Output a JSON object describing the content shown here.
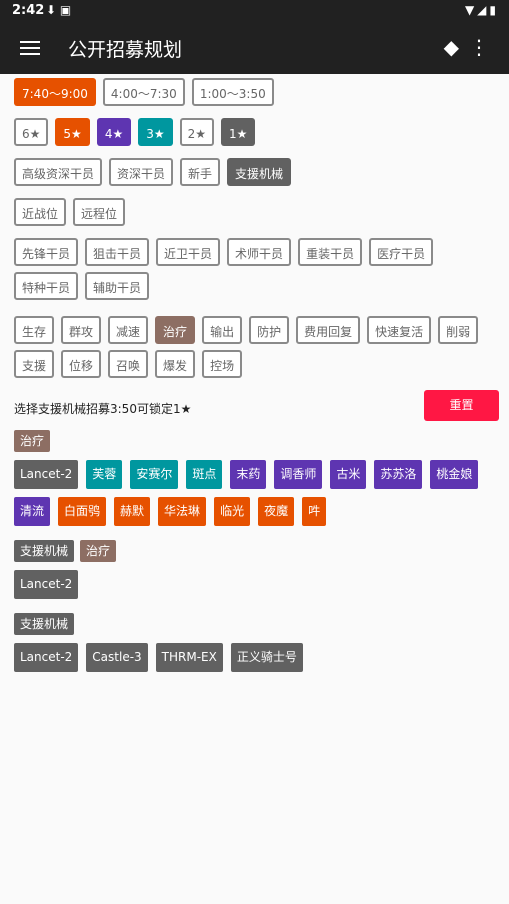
{
  "status": {
    "time": "2:42"
  },
  "appbar": {
    "title": "公开招募规划"
  },
  "time_options": [
    {
      "label": "7:40～9:00",
      "selected": true
    },
    {
      "label": "4:00～7:30",
      "selected": false
    },
    {
      "label": "1:00～3:50",
      "selected": false
    }
  ],
  "stars": [
    {
      "label": "6★",
      "selected": false,
      "color": ""
    },
    {
      "label": "5★",
      "selected": true,
      "color": "orange"
    },
    {
      "label": "4★",
      "selected": true,
      "color": "purple"
    },
    {
      "label": "3★",
      "selected": true,
      "color": "teal"
    },
    {
      "label": "2★",
      "selected": false,
      "color": ""
    },
    {
      "label": "1★",
      "selected": true,
      "color": "gray"
    }
  ],
  "qualifications": [
    {
      "label": "高级资深干员",
      "selected": false
    },
    {
      "label": "资深干员",
      "selected": false
    },
    {
      "label": "新手",
      "selected": false
    },
    {
      "label": "支援机械",
      "selected": true
    }
  ],
  "positions": [
    {
      "label": "近战位",
      "selected": false
    },
    {
      "label": "远程位",
      "selected": false
    }
  ],
  "classes": [
    {
      "label": "先锋干员",
      "selected": false
    },
    {
      "label": "狙击干员",
      "selected": false
    },
    {
      "label": "近卫干员",
      "selected": false
    },
    {
      "label": "术师干员",
      "selected": false
    },
    {
      "label": "重装干员",
      "selected": false
    },
    {
      "label": "医疗干员",
      "selected": false
    },
    {
      "label": "特种干员",
      "selected": false
    },
    {
      "label": "辅助干员",
      "selected": false
    }
  ],
  "affixes": [
    {
      "label": "生存",
      "selected": false
    },
    {
      "label": "群攻",
      "selected": false
    },
    {
      "label": "减速",
      "selected": false
    },
    {
      "label": "治疗",
      "selected": true
    },
    {
      "label": "输出",
      "selected": false
    },
    {
      "label": "防护",
      "selected": false
    },
    {
      "label": "费用回复",
      "selected": false
    },
    {
      "label": "快速复活",
      "selected": false
    },
    {
      "label": "削弱",
      "selected": false
    },
    {
      "label": "支援",
      "selected": false
    },
    {
      "label": "位移",
      "selected": false
    },
    {
      "label": "召唤",
      "selected": false
    },
    {
      "label": "爆发",
      "selected": false
    },
    {
      "label": "控场",
      "selected": false
    }
  ],
  "hint": "选择支援机械招募3:50可锁定1★",
  "reset_label": "重置",
  "results": [
    {
      "tags": [
        {
          "label": "治疗",
          "color": "brown"
        }
      ],
      "operators": [
        {
          "name": "Lancet-2",
          "color": "gray"
        },
        {
          "name": "芙蓉",
          "color": "teal"
        },
        {
          "name": "安赛尔",
          "color": "teal"
        },
        {
          "name": "斑点",
          "color": "teal"
        },
        {
          "name": "末药",
          "color": "purple"
        },
        {
          "name": "调香师",
          "color": "purple"
        },
        {
          "name": "古米",
          "color": "purple"
        },
        {
          "name": "苏苏洛",
          "color": "purple"
        },
        {
          "name": "桃金娘",
          "color": "purple"
        },
        {
          "name": "清流",
          "color": "purple"
        },
        {
          "name": "白面鸮",
          "color": "orange"
        },
        {
          "name": "赫默",
          "color": "orange"
        },
        {
          "name": "华法琳",
          "color": "orange"
        },
        {
          "name": "临光",
          "color": "orange"
        },
        {
          "name": "夜魔",
          "color": "orange"
        },
        {
          "name": "吽",
          "color": "orange"
        }
      ]
    },
    {
      "tags": [
        {
          "label": "支援机械",
          "color": "gray"
        },
        {
          "label": "治疗",
          "color": "brown"
        }
      ],
      "operators": [
        {
          "name": "Lancet-2",
          "color": "gray"
        }
      ]
    },
    {
      "tags": [
        {
          "label": "支援机械",
          "color": "gray"
        }
      ],
      "operators": [
        {
          "name": "Lancet-2",
          "color": "gray"
        },
        {
          "name": "Castle-3",
          "color": "gray"
        },
        {
          "name": "THRM-EX",
          "color": "gray"
        },
        {
          "name": "正义骑士号",
          "color": "gray"
        }
      ]
    }
  ],
  "colors": {
    "appbar": "#212121",
    "orange": "#e65100",
    "purple": "#5e35b1",
    "teal": "#00979f",
    "gray": "#616161",
    "brown": "#8d6e63",
    "reset": "#ff1744"
  }
}
